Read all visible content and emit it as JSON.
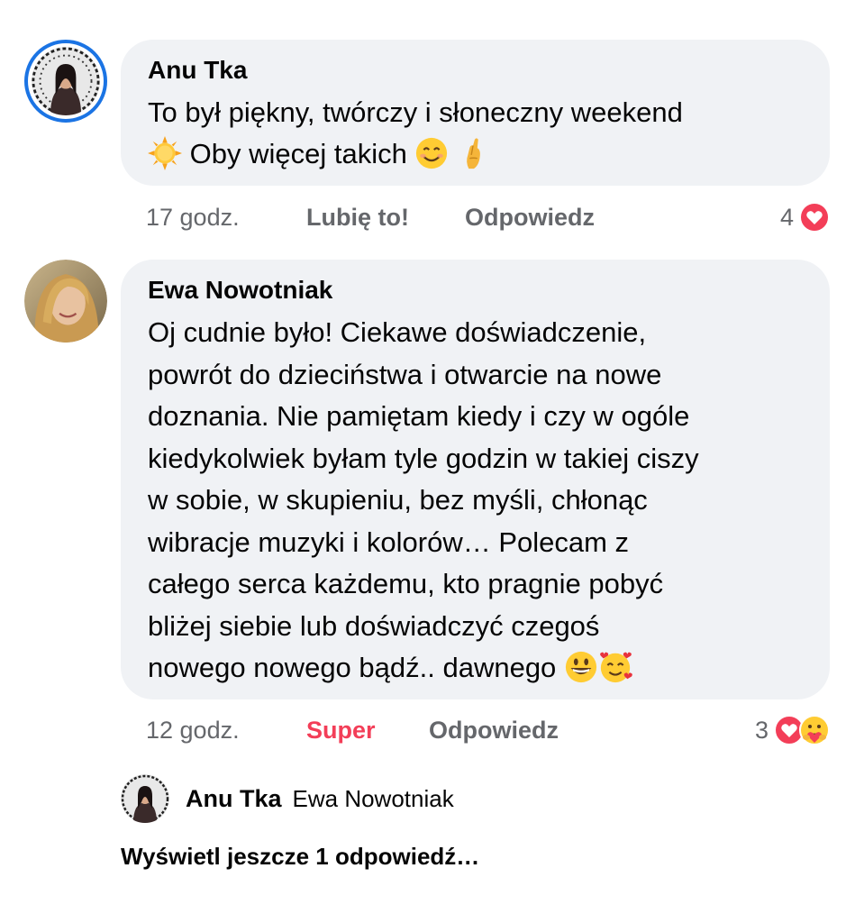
{
  "comments": [
    {
      "author": "Anu Tka",
      "text_line1": "To był piękny, twórczy i słoneczny weekend",
      "text_line2": " Oby więcej takich",
      "time": "17 godz.",
      "like_label": "Lubię to!",
      "reply_label": "Odpowiedz",
      "reaction_count": "4",
      "emojis": [
        "sun-emoji",
        "smiling-face-emoji",
        "crossed-fingers-emoji"
      ]
    },
    {
      "author": "Ewa Nowotniak",
      "lines": [
        "Oj cudnie było! Ciekawe doświadczenie,",
        "powrót do dzieciństwa i otwarcie na nowe",
        "doznania. Nie pamiętam kiedy i czy w ogóle",
        "kiedykolwiek byłam tyle godzin w takiej ciszy",
        "w sobie, w skupieniu, bez myśli, chłonąc",
        "wibracje muzyki i kolorów… Polecam z",
        "całego serca każdemu, kto pragnie pobyć",
        "bliżej siebie lub doświadczyć czegoś",
        "nowego nowego bądź.. dawnego "
      ],
      "time": "12 godz.",
      "like_label": "Super",
      "reply_label": "Odpowiedz",
      "reaction_count": "3",
      "emojis": [
        "grinning-face-emoji",
        "smiling-face-with-hearts-emoji"
      ]
    }
  ],
  "reply_preview": {
    "author": "Anu Tka",
    "mention": "Ewa Nowotniak"
  },
  "more_replies_label": "Wyświetl jeszcze 1 odpowiedź…",
  "colors": {
    "bubble": "#f0f2f5",
    "story_ring": "#1b74e4",
    "super": "#f33e58",
    "muted": "#65676b"
  }
}
